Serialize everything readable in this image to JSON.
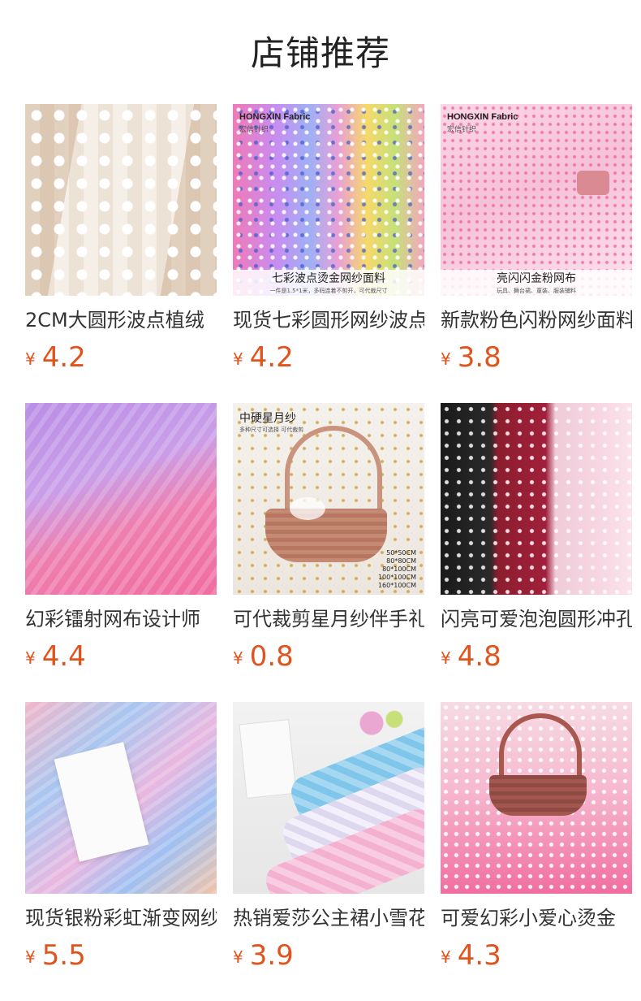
{
  "page": {
    "title": "店铺推荐"
  },
  "price_symbol": "¥",
  "products": [
    {
      "name": "2CM大圆形波点植绒",
      "price": "4.2"
    },
    {
      "name": "现货七彩圆形网纱波点",
      "price": "4.2",
      "brand": "HONGXIN Fabric",
      "brand_sub": "宏信针织",
      "caption": "七彩波点烫金网纱面料",
      "caption_sub": "一件是1.5*1米，多码连着不剪开，可代裁尺寸"
    },
    {
      "name": "新款粉色闪粉网纱面料",
      "price": "3.8",
      "brand": "HONGXIN Fabric",
      "brand_sub": "宏信针织",
      "caption": "亮闪闪金粉网布",
      "caption_sub": "玩具、舞台裙、童装、服装辅料"
    },
    {
      "name": "幻彩镭射网布设计师",
      "price": "4.4"
    },
    {
      "name": "可代裁剪星月纱伴手礼",
      "price": "0.8",
      "topleft": "中硬星月纱",
      "topleft_sub": "多种尺寸可选择 可代裁剪",
      "sizes": [
        "50*50CM",
        "80*80CM",
        "80*100CM",
        "100*100CM",
        "160*100CM"
      ]
    },
    {
      "name": "闪亮可爱泡泡圆形冲孔",
      "price": "4.8"
    },
    {
      "name": "现货银粉彩虹渐变网纱",
      "price": "5.5"
    },
    {
      "name": "热销爱莎公主裙小雪花",
      "price": "3.9"
    },
    {
      "name": "可爱幻彩小爱心烫金",
      "price": "4.3"
    }
  ]
}
